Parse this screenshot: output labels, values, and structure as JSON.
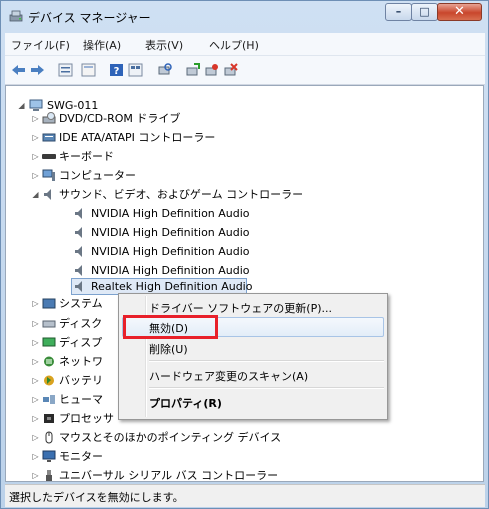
{
  "window": {
    "title": "デバイス マネージャー"
  },
  "menu": [
    "ファイル(F)",
    "操作(A)",
    "表示(V)",
    "ヘルプ(H)"
  ],
  "toolbar_icons": [
    "back-arrow-icon",
    "forward-arrow-icon",
    "view-list-icon",
    "properties-icon",
    "help-icon",
    "view-detail-icon",
    "scan-hardware-icon",
    "update-driver-icon",
    "disable-device-icon",
    "uninstall-device-icon"
  ],
  "tree": {
    "root": "SWG-011",
    "categories": {
      "dvd": "DVD/CD-ROM ドライブ",
      "ide": "IDE ATA/ATAPI コントローラー",
      "keyboard": "キーボード",
      "computer": "コンピューター",
      "sound": "サウンド、ビデオ、およびゲーム コントローラー",
      "system": "システム",
      "disk": "ディスク",
      "display": "ディスプ",
      "network": "ネットワ",
      "battery": "バッテリ",
      "hid": "ヒューマ",
      "processor": "プロセッサ",
      "mouse": "マウスとそのほかのポインティング デバイス",
      "monitor": "モニター",
      "usb": "ユニバーサル シリアル バス コントローラー"
    },
    "sound_devices": [
      "NVIDIA High Definition Audio",
      "NVIDIA High Definition Audio",
      "NVIDIA High Definition Audio",
      "NVIDIA High Definition Audio",
      "Realtek High Definition Audio"
    ]
  },
  "context_menu": {
    "update_driver": "ドライバー ソフトウェアの更新(P)...",
    "disable": "無効(D)",
    "uninstall": "削除(U)",
    "scan": "ハードウェア変更のスキャン(A)",
    "properties": "プロパティ(R)"
  },
  "status": "選択したデバイスを無効にします。",
  "colors": {
    "highlight": "#e8202a",
    "selection": "#dfe9f6"
  }
}
